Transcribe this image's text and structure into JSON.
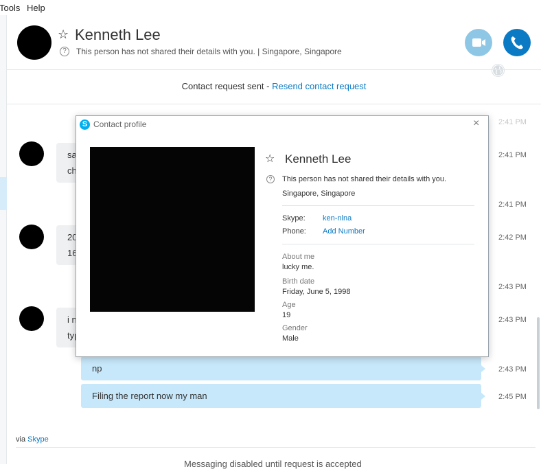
{
  "menu": {
    "items": [
      "Tools",
      "Help"
    ]
  },
  "header": {
    "name": "Kenneth Lee",
    "status": "This person has not shared their details with you.  |  Singapore, Singapore",
    "icons": {
      "star": "star-icon",
      "info": "info-icon",
      "video": "video-call-icon",
      "call": "phone-icon",
      "globe": "globe-icon"
    }
  },
  "contact_request": {
    "text": "Contact request sent - ",
    "link": "Resend contact request"
  },
  "chat": {
    "incoming": [
      {
        "line1": "sa",
        "line2": "ch"
      },
      {
        "line1": "20",
        "line2": "16"
      },
      {
        "line1": "i n",
        "line2": "typ"
      }
    ],
    "outgoing": [
      "np",
      "Filing the report now my man"
    ],
    "times": [
      "2:41 PM",
      "2:41 PM",
      "2:41 PM",
      "2:42 PM",
      "2:43 PM",
      "2:43 PM",
      "2:43 PM",
      "2:45 PM"
    ]
  },
  "footer": {
    "via_prefix": "via ",
    "via_link": "Skype",
    "notice": "Messaging disabled until request is accepted"
  },
  "dialog": {
    "title": "Contact profile",
    "close": "×",
    "logo": "S",
    "name": "Kenneth Lee",
    "details_note": "This person has not shared their details with you.",
    "location": "Singapore, Singapore",
    "skype_label": "Skype:",
    "skype_value": "ken-nlna",
    "phone_label": "Phone:",
    "phone_value": "Add Number",
    "about_label": "About me",
    "about_value": "lucky me.",
    "birth_label": "Birth date",
    "birth_value": "Friday, June 5, 1998",
    "age_label": "Age",
    "age_value": "19",
    "gender_label": "Gender",
    "gender_value": "Male"
  },
  "colors": {
    "accent": "#0a7ac4",
    "video_button": "#8ec7e6",
    "outgoing_bubble": "#c7e8fa",
    "incoming_bubble": "#eef0f2",
    "skype_blue": "#00aff0"
  }
}
